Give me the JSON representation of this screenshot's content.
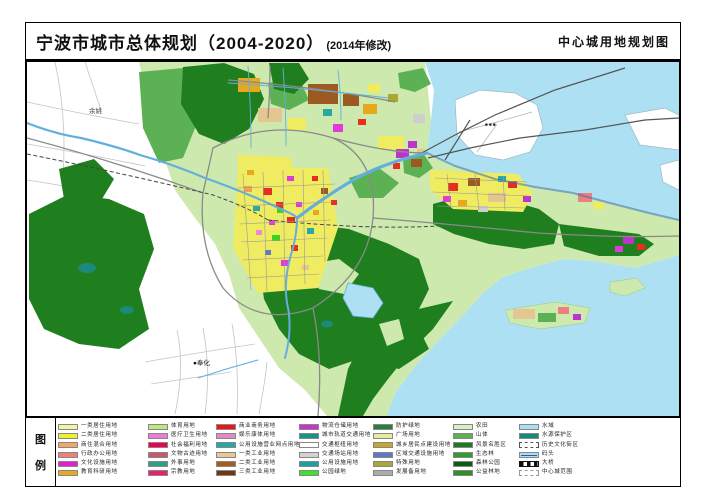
{
  "header": {
    "title_main": "宁波市城市总体规划（2004-2020）",
    "revision_note": "(2014年修改)",
    "subtitle_right": "中心城用地规划图"
  },
  "legend": {
    "title_chars": [
      "图",
      "例"
    ],
    "columns": [
      {
        "items": [
          {
            "label": "一类居住用地",
            "color": "#f7f3a6"
          },
          {
            "label": "二类居住用地",
            "color": "#f4ef2b"
          },
          {
            "label": "商住混合用地",
            "color": "#f0a868"
          },
          {
            "label": "行政办公用地",
            "color": "#ee7f7f"
          },
          {
            "label": "文化设施用地",
            "color": "#e020d0"
          },
          {
            "label": "教育科研用地",
            "color": "#e8a81e"
          }
        ]
      },
      {
        "items": [
          {
            "label": "体育用地",
            "color": "#bce87c"
          },
          {
            "label": "医疗卫生用地",
            "color": "#f07ad8"
          },
          {
            "label": "社会福利用地",
            "color": "#f00050"
          },
          {
            "label": "文物古迹用地",
            "color": "#c85a70"
          },
          {
            "label": "外事用地",
            "color": "#2f9e82"
          },
          {
            "label": "宗教用地",
            "color": "#e9206a"
          }
        ]
      },
      {
        "items": [
          {
            "label": "商业商务用地",
            "color": "#e81818"
          },
          {
            "label": "娱乐康体用地",
            "color": "#e688c8"
          },
          {
            "label": "公用设施营业网点用地",
            "color": "#28a8a4"
          },
          {
            "label": "一类工业用地",
            "color": "#e7c893"
          },
          {
            "label": "二类工业用地",
            "color": "#a35f22"
          },
          {
            "label": "三类工业用地",
            "color": "#6e3a12"
          }
        ]
      },
      {
        "items": [
          {
            "label": "物流仓储用地",
            "color": "#c934c9"
          },
          {
            "label": "城市轨道交通用地",
            "color": "#15948c"
          },
          {
            "label": "交通枢纽用地",
            "color": "#ffffff"
          },
          {
            "label": "交通场站用地",
            "color": "#d2d2d2"
          },
          {
            "label": "公用设施用地",
            "color": "#1fa0a0"
          },
          {
            "label": "公园绿地",
            "color": "#3be32b"
          }
        ]
      },
      {
        "items": [
          {
            "label": "防护绿地",
            "color": "#2a7d3a"
          },
          {
            "label": "广场用地",
            "color": "#e9e9a0"
          },
          {
            "label": "城乡居民点建设用地",
            "color": "#c7a52f"
          },
          {
            "label": "区域交通设施用地",
            "color": "#5b79c4"
          },
          {
            "label": "特殊用地",
            "color": "#a8a832"
          },
          {
            "label": "发展备用地",
            "color": "#ababab"
          }
        ]
      },
      {
        "items": [
          {
            "label": "农田",
            "color": "#d9f0c2"
          },
          {
            "label": "山体",
            "color": "#5cb154"
          },
          {
            "label": "风景名胜区",
            "color": "#1d7a1d"
          },
          {
            "label": "生态林",
            "color": "#2f9e2f"
          },
          {
            "label": "森林公园",
            "color": "#0f5c10"
          },
          {
            "label": "公益林地",
            "color": "#2f8f1f"
          }
        ]
      },
      {
        "items": [
          {
            "label": "水域",
            "color": "#abdcf2"
          },
          {
            "label": "水源保护区",
            "color": "#15897b"
          },
          {
            "label": "历史文化街区",
            "color": "#ffffff",
            "type": "dashed"
          },
          {
            "label": "码头",
            "color": "#abdcf2",
            "type": "pier"
          },
          {
            "label": "大桥",
            "color": "#ffffff",
            "type": "bridge"
          },
          {
            "label": "中心城范围",
            "color": "#ffffff",
            "type": "boundary"
          }
        ]
      }
    ]
  },
  "map": {
    "labels": [
      {
        "text": "余姚"
      },
      {
        "text": "●奉化"
      }
    ],
    "island_marks": "■ ■ ■",
    "palette": {
      "sea": "#aee0f4",
      "farmland": "#cde9ae",
      "mountain": "#1f7f1f",
      "residential": "#f0ec62",
      "river": "#64aede"
    }
  }
}
